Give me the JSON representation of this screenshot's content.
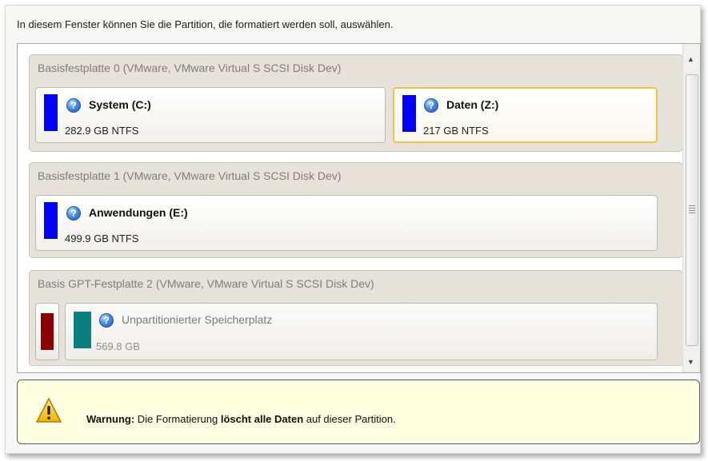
{
  "instruction": "In diesem Fenster können Sie die Partition, die formatiert werden soll, auswählen.",
  "disks": [
    {
      "title": "Basisfestplatte 0 (VMware, VMware Virtual S SCSI Disk Dev)",
      "partitions": [
        {
          "name": "System (C:)",
          "info": "282.9 GB NTFS",
          "color": "#0000ff",
          "selected": false
        },
        {
          "name": "Daten (Z:)",
          "info": "217 GB NTFS",
          "color": "#0000ff",
          "selected": true
        }
      ]
    },
    {
      "title": "Basisfestplatte 1 (VMware, VMware Virtual S SCSI Disk Dev)",
      "partitions": [
        {
          "name": "Anwendungen (E:)",
          "info": "499.9 GB NTFS",
          "color": "#0000ff",
          "selected": false
        }
      ]
    },
    {
      "title": "Basis GPT-Festplatte 2 (VMware, VMware Virtual S SCSI Disk Dev)",
      "reserved_color": "#8b0000",
      "partitions": [
        {
          "name": "Unpartitionierter Speicherplatz",
          "info": "569.8 GB",
          "color": "#0a8080",
          "selected": false
        }
      ]
    }
  ],
  "help_icon": "question-icon",
  "warning": {
    "icon": "warning-triangle-icon",
    "label": "Warnung:",
    "text_before": " Die Formatierung ",
    "text_bold": "löscht alle Daten",
    "text_after": " auf dieser Partition."
  }
}
